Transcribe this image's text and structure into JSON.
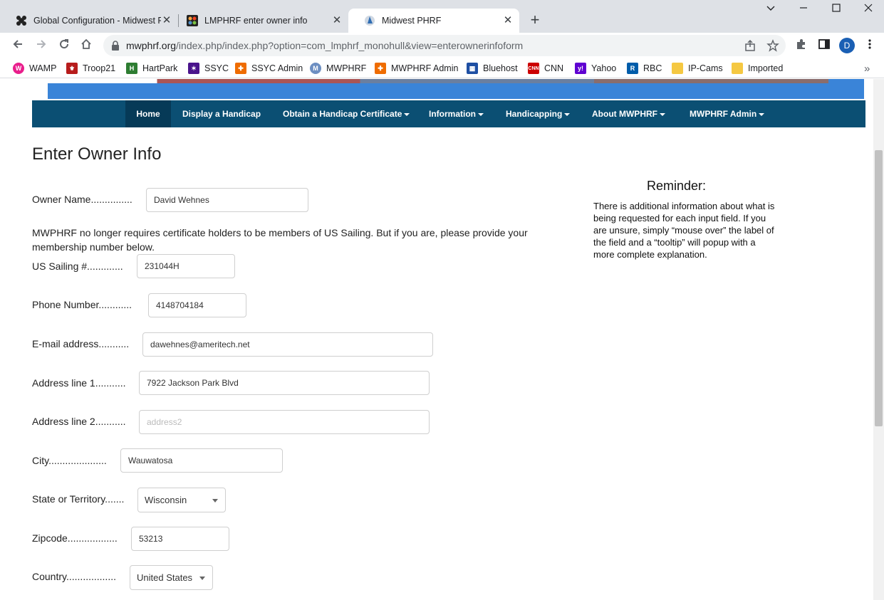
{
  "tabs": [
    {
      "title": "Global Configuration - Midwest P",
      "icon": "joomla-icon"
    },
    {
      "title": "LMPHRF enter owner info",
      "icon": "joomla-icon"
    },
    {
      "title": "Midwest PHRF",
      "icon": "mwphrf-icon"
    }
  ],
  "toolbar": {
    "url_host": "mwphrf.org",
    "url_path": "/index.php/index.php?option=com_lmphrf_monohull&view=enterownerinfoform",
    "profile_initial": "D"
  },
  "bookmarks": [
    "WAMP",
    "Troop21",
    "HartPark",
    "SSYC",
    "SSYC Admin",
    "MWPHRF",
    "MWPHRF Admin",
    "Bluehost",
    "CNN",
    "Yahoo",
    "RBC",
    "IP-Cams",
    "Imported"
  ],
  "nav": {
    "items": [
      "Home",
      "Display a Handicap",
      "Obtain a Handicap Certificate",
      "Information",
      "Handicapping",
      "About MWPHRF",
      "MWPHRF Admin"
    ]
  },
  "page": {
    "title": "Enter Owner Info",
    "note": "MWPHRF no longer requires certificate holders to be members of US Sailing. But if you are, please provide your membership number below."
  },
  "form": {
    "owner_label": "Owner Name...............",
    "owner_value": "David Wehnes",
    "ussailing_label": "US Sailing #.............",
    "ussailing_value": "231044H",
    "phone_label": "Phone Number............",
    "phone_value": "4148704184",
    "email_label": "E-mail address...........",
    "email_value": "dawehnes@ameritech.net",
    "addr1_label": "Address line 1...........",
    "addr1_value": "7922 Jackson Park Blvd",
    "addr2_label": "Address line 2...........",
    "addr2_placeholder": "address2",
    "city_label": "City.....................",
    "city_value": "Wauwatosa",
    "state_label": "State or Territory.......",
    "state_value": "Wisconsin",
    "zip_label": "Zipcode..................",
    "zip_value": "53213",
    "country_label": "Country..................",
    "country_value": "United States"
  },
  "reminder": {
    "title": "Reminder:",
    "text": "There is additional information about what is being requested for each input field.  If you are unsure, simply “mouse over” the label of the field and a “tooltip” will popup with a more complete explanation."
  }
}
